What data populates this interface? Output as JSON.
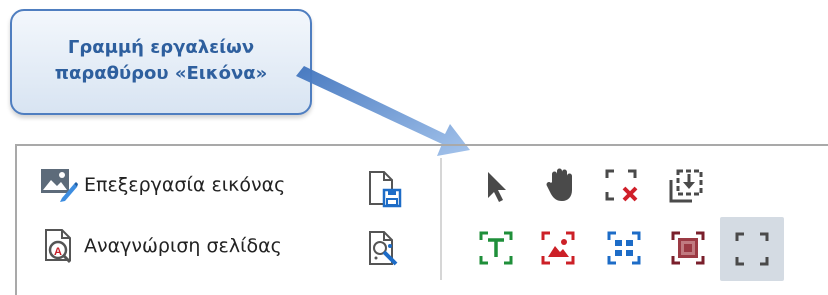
{
  "callout": {
    "line1": "Γραμμή εργαλείων",
    "line2": "παραθύρου «Εικόνα»"
  },
  "toolbar": {
    "edit_image_label": "Επεξεργασία εικόνας",
    "recognize_page_label": "Αναγνώριση σελίδας",
    "tools": {
      "select": "cursor-arrow-icon",
      "pan": "hand-icon",
      "delete_area": "delete-area-icon",
      "load_area": "load-area-icon",
      "text_area": "text-area-icon",
      "picture_area": "picture-area-icon",
      "table_area": "table-area-icon",
      "background_picture_area": "background-picture-area-icon",
      "recognition_area": "recognition-area-icon"
    },
    "colors": {
      "text_area": "#1f8f3a",
      "picture_area": "#cc2027",
      "table_area": "#1d6cc7",
      "background_picture_area": "#7a1f2b",
      "callout_text": "#2e5f9e",
      "arrow": "#5b8ed3"
    }
  }
}
